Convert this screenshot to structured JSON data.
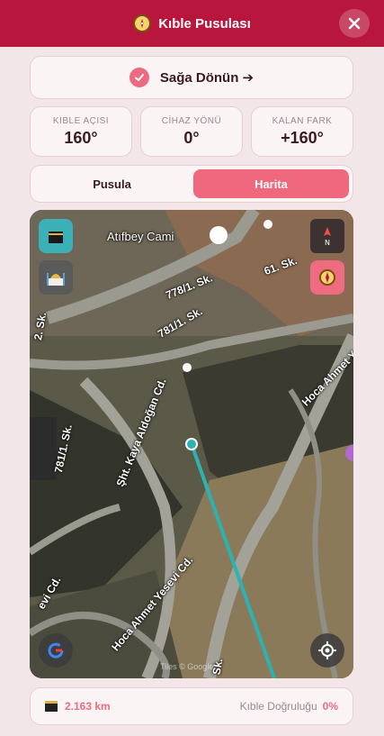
{
  "header": {
    "title": "Kıble Pusulası",
    "icon": "compass-icon",
    "close_icon": "close-icon"
  },
  "turn": {
    "text": "Sağa Dönün ➔",
    "status_icon": "check-icon"
  },
  "stats": [
    {
      "label": "KIBLE AÇISI",
      "value": "160°"
    },
    {
      "label": "CİHAZ YÖNÜ",
      "value": "0°"
    },
    {
      "label": "KALAN FARK",
      "value": "+160°"
    }
  ],
  "tabs": [
    {
      "label": "Pusula",
      "active": false
    },
    {
      "label": "Harita",
      "active": true
    }
  ],
  "map": {
    "poi_name": "Atıfbey Cami",
    "streets": [
      "778/1. Sk.",
      "781/1. Sk.",
      "61. Sk.",
      "Hoca Ahmet Y",
      "Şht. Kaya Aldoğan Cd.",
      "781/1. Sk.",
      "Hoca Ahmet Yesevi Cd.",
      "Sk.",
      "evi Cd.",
      "2. Sk."
    ],
    "attribution": "Tiles © Google",
    "buttons": [
      "kaaba-icon",
      "mosque-icon",
      "north-icon",
      "compass-icon",
      "google-icon",
      "locate-icon"
    ]
  },
  "footer": {
    "distance": "2.163 km",
    "accuracy_label": "Kıble Doğruluğu",
    "accuracy_value": "0%"
  },
  "colors": {
    "header": "#b8163c",
    "accent": "#f0687e",
    "background": "#f3e6e8",
    "qibla_line": "#2bb3b3"
  }
}
